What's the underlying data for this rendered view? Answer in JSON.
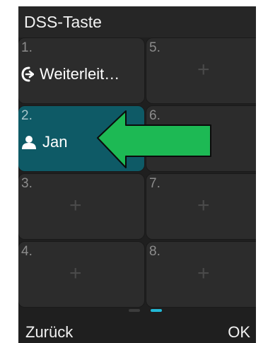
{
  "window": {
    "title": "DSS-Taste"
  },
  "keys": [
    {
      "num": "1.",
      "label": "Weiterleit…",
      "icon": "call-forward-icon"
    },
    {
      "num": "2.",
      "label": "Jan",
      "icon": "contact-person-icon"
    },
    {
      "num": "3.",
      "plus": "+"
    },
    {
      "num": "4.",
      "plus": "+"
    },
    {
      "num": "5.",
      "plus": "+"
    },
    {
      "num": "6.",
      "plus": "+"
    },
    {
      "num": "7.",
      "plus": "+"
    },
    {
      "num": "8.",
      "plus": "+"
    }
  ],
  "softkeys": {
    "back": "Zurück",
    "ok": "OK"
  },
  "page_indicator": {
    "current_page": 2,
    "total_pages": 2
  },
  "colors": {
    "background": "#1f1f1f",
    "tile": "#2c2c2c",
    "tile_selected": "#0e5a66",
    "indicator_active": "#22b8d6",
    "annotation_arrow": "#1db954"
  }
}
